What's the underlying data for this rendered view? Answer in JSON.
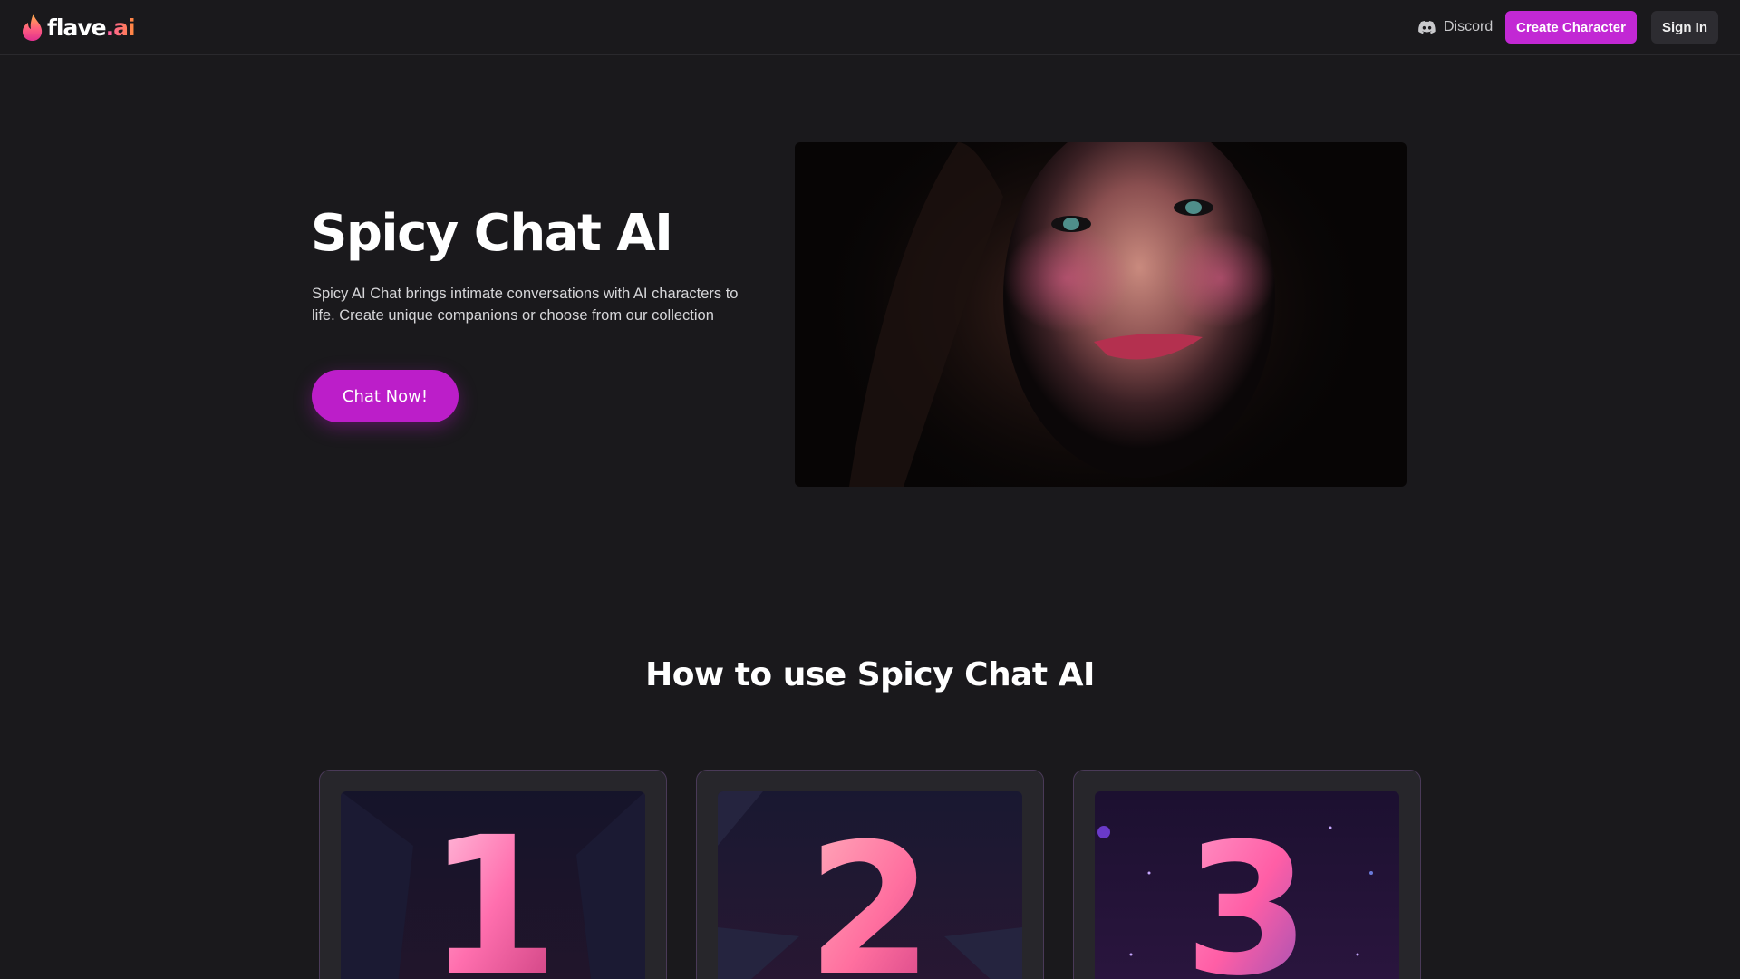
{
  "header": {
    "logo": {
      "name": "flave",
      "tld": ".ai"
    },
    "discord_label": "Discord",
    "create_label": "Create Character",
    "signin_label": "Sign In"
  },
  "hero": {
    "title": "Spicy Chat AI",
    "description": "Spicy AI Chat brings intimate conversations with AI characters to life. Create unique companions or choose from our collection",
    "cta_label": "Chat Now!"
  },
  "howto": {
    "title": "How to use Spicy Chat AI",
    "steps": [
      {
        "number": "1"
      },
      {
        "number": "2"
      },
      {
        "number": "3"
      }
    ]
  },
  "colors": {
    "background": "#1a191c",
    "accent": "#c228d4",
    "secondary_button": "#2d2c31",
    "card": "#27262b",
    "card_border": "#4a3a58"
  },
  "icons": {
    "logo": "flame-icon",
    "discord": "discord-icon"
  }
}
